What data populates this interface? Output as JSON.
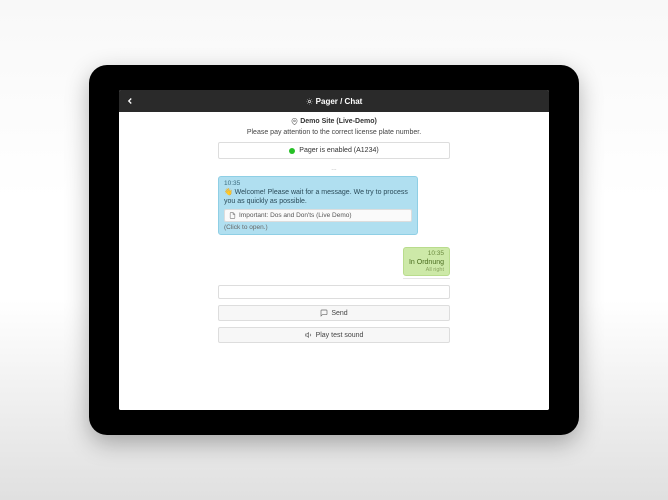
{
  "header": {
    "title": "Pager / Chat"
  },
  "site": {
    "label": "Demo Site (Live-Demo)"
  },
  "notice": "Please pay attention to the correct license plate number.",
  "pager": {
    "status_text": "Pager is enabled (A1234)"
  },
  "truncated_placeholder": "...",
  "messages": {
    "left": {
      "time": "10:35",
      "text": "👋 Welcome! Please wait for a message. We try to process you as quickly as possible.",
      "attachment_label": "Important: Dos and Don'ts (Live Demo)",
      "expand_label": "(Click to open.)"
    },
    "right": {
      "time": "10:35",
      "text": "In Ordnung",
      "sub": "All right"
    }
  },
  "buttons": {
    "send": "Send",
    "play_sound": "Play test sound"
  }
}
